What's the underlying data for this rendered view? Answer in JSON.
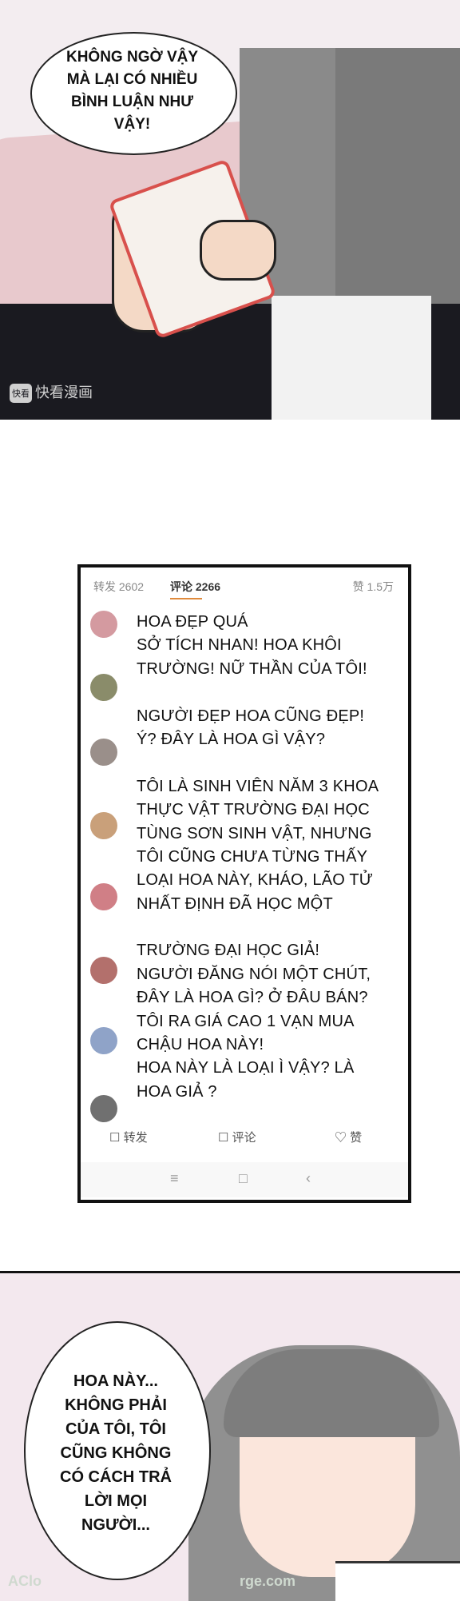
{
  "panel1": {
    "speech_lines": [
      "KHÔNG NGỜ VẬY",
      "MÀ LẠI CÓ NHIỀU",
      "BÌNH LUẬN NHƯ",
      "VẬY!"
    ],
    "watermark_logo": "快看",
    "watermark_text": "快看漫画"
  },
  "screenshot": {
    "stat_forward": "转发 2602",
    "stat_comments": "评论 2266",
    "stat_likes": "赞 1.5万",
    "lines": [
      "HOA ĐẸP QUÁ",
      "SỞ TÍCH NHAN! HOA KHÔI",
      "TRƯỜNG! NỮ THẦN CỦA TÔI!",
      "",
      "NGƯỜI ĐẸP HOA CŨNG ĐẸP!",
      "Ý? ĐÂY LÀ HOA GÌ VẬY?",
      "",
      "TÔI LÀ SINH VIÊN NĂM 3 KHOA",
      "THỰC VẬT TRƯỜNG ĐẠI HỌC",
      "TÙNG SƠN SINH VẬT, NHƯNG",
      "TÔI CŨNG CHƯA TỪNG THẤY",
      "LOẠI HOA NÀY, KHÁO, LÃO TỬ",
      "NHẤT ĐỊNH ĐÃ HỌC MỘT",
      "",
      "TRƯỜNG ĐẠI HỌC GIẢ!",
      "NGƯỜI ĐĂNG NÓI MỘT CHÚT,",
      "ĐÂY LÀ HOA GÌ? Ở ĐÂU BÁN?",
      "TÔI RA GIÁ CAO 1 VẠN MUA",
      "CHẬU HOA NÀY!",
      "HOA NÀY LÀ LOẠI Ì VẬY? LÀ",
      "HOA GIẢ ?"
    ],
    "action_forward": "☐ 转发",
    "action_comment": "☐ 评论",
    "action_like": "♡ 赞",
    "nav_menu": "≡",
    "nav_home": "□",
    "nav_back": "‹"
  },
  "panel3": {
    "speech_lines": [
      "HOA NÀY...",
      "KHÔNG PHẢI",
      "CỦA TÔI, TÔI",
      "CŨNG KHÔNG",
      "CÓ CÁCH TRẢ",
      "LỜI MỌI",
      "NGƯỜI..."
    ],
    "watermark_left": "AClo",
    "watermark_right": "rge.com"
  },
  "colors": {
    "avatar_colors": [
      "#d49aa0",
      "#8a8c6a",
      "#9a8f8a",
      "#c9a07a",
      "#d07f86",
      "#b3706c",
      "#8fa3c8",
      "#707070"
    ]
  }
}
